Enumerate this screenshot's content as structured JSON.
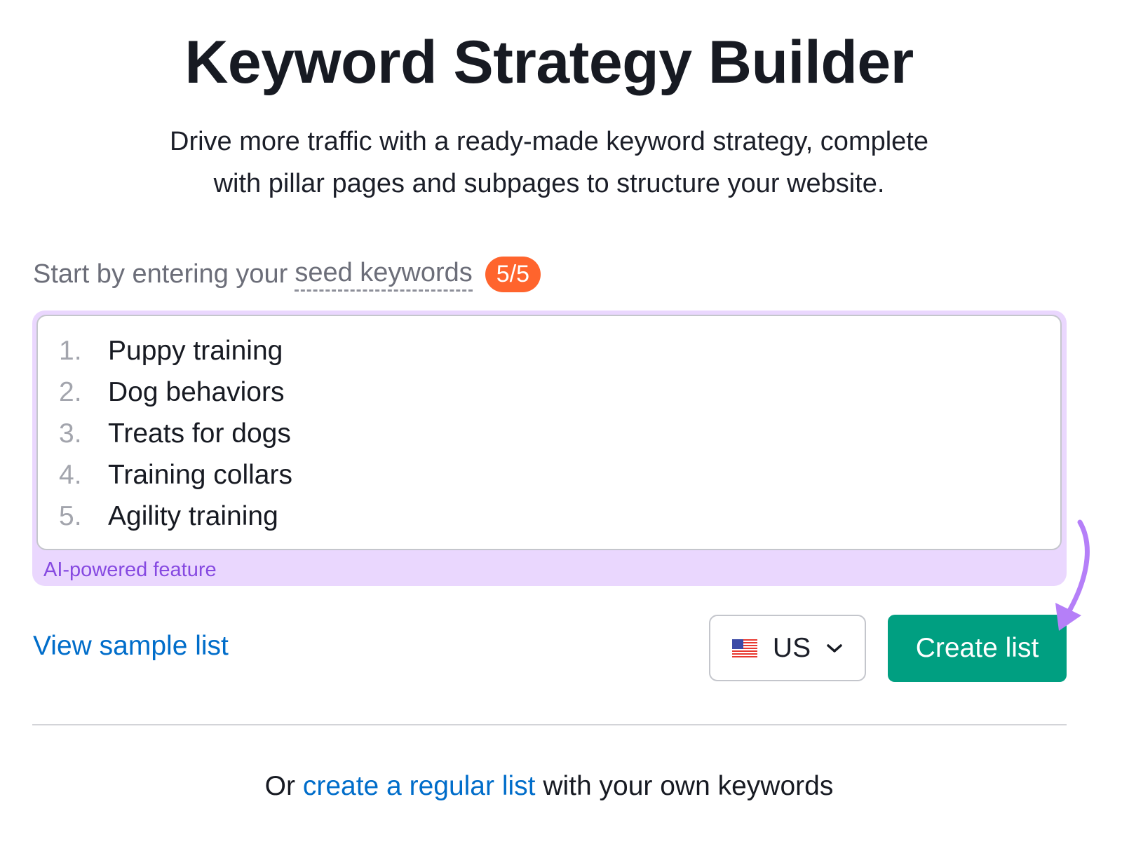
{
  "header": {
    "title": "Keyword Strategy Builder",
    "subtitle_line1": "Drive more traffic with a ready-made keyword strategy, complete",
    "subtitle_line2": "with pillar pages and subpages to structure your website."
  },
  "form": {
    "prompt_prefix": "Start by entering your",
    "prompt_link": "seed keywords",
    "count_badge": "5/5",
    "keywords": [
      {
        "num": "1.",
        "text": "Puppy training"
      },
      {
        "num": "2.",
        "text": "Dog behaviors"
      },
      {
        "num": "3.",
        "text": "Treats for dogs"
      },
      {
        "num": "4.",
        "text": "Training collars"
      },
      {
        "num": "5.",
        "text": "Agility training"
      }
    ],
    "ai_label": "AI-powered feature"
  },
  "actions": {
    "view_sample": "View sample list",
    "country": "US",
    "country_icon": "us-flag-icon",
    "create_button": "Create list"
  },
  "footer": {
    "prefix": "Or",
    "link": "create a regular list",
    "suffix": "with your own keywords"
  },
  "colors": {
    "badge": "#ff642d",
    "primary": "#009f81",
    "link": "#006dca",
    "ai_bg": "#ead7fe",
    "ai_text": "#8649e1",
    "annotation_arrow": "#b57ff8"
  }
}
